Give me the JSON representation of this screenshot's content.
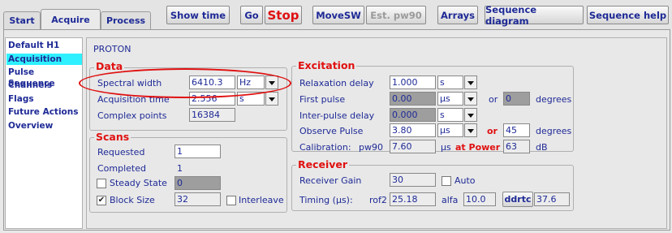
{
  "tabs": [
    {
      "label": "Start"
    },
    {
      "label": "Acquire"
    },
    {
      "label": "Process"
    }
  ],
  "toolbar": {
    "show_time": "Show time",
    "go": "Go",
    "stop": "Stop",
    "movesw": "MoveSW",
    "est_pw90": "Est. pw90",
    "arrays": "Arrays",
    "sequence_diagram": "Sequence diagram",
    "sequence_help": "Sequence help"
  },
  "nav": {
    "items": [
      {
        "label": "Default H1"
      },
      {
        "label": "Acquisition"
      },
      {
        "label": "Pulse Sequence"
      },
      {
        "label": "Channels"
      },
      {
        "label": "Flags"
      },
      {
        "label": "Future Actions"
      },
      {
        "label": "Overview"
      }
    ]
  },
  "nucleus": "PROTON",
  "data_group": {
    "title": "Data",
    "spectral_width_label": "Spectral width",
    "spectral_width_value": "6410.3",
    "spectral_width_unit": "Hz",
    "acq_time_label": "Acquisition time",
    "acq_time_value": "2.556",
    "acq_time_unit": "s",
    "complex_points_label": "Complex points",
    "complex_points_value": "16384"
  },
  "scans_group": {
    "title": "Scans",
    "requested_label": "Requested",
    "requested_value": "1",
    "completed_label": "Completed",
    "completed_value": "1",
    "steady_state_label": "Steady State",
    "steady_state_value": "0",
    "block_size_label": "Block Size",
    "block_size_value": "32",
    "block_size_check": "✔",
    "interleave_label": "Interleave"
  },
  "excitation_group": {
    "title": "Excitation",
    "relax_label": "Relaxation delay",
    "relax_value": "1.000",
    "relax_unit": "s",
    "first_pulse_label": "First pulse",
    "first_pulse_value": "0.00",
    "first_pulse_unit": "μs",
    "first_or": "or",
    "first_deg_value": "0",
    "first_deg_label": "degrees",
    "inter_label": "Inter-pulse delay",
    "inter_value": "0.000",
    "inter_unit": "s",
    "observe_label": "Observe Pulse",
    "observe_value": "3.80",
    "observe_unit": "μs",
    "observe_or": "or",
    "observe_deg_value": "45",
    "observe_deg_label": "degrees",
    "calib_label": "Calibration:",
    "pw90_label": "pw90",
    "pw90_value": "7.60",
    "pw90_unit": "μs",
    "at_power_label": "at Power",
    "power_value": "63",
    "power_unit": "dB"
  },
  "receiver_group": {
    "title": "Receiver",
    "gain_label": "Receiver Gain",
    "gain_value": "30",
    "auto_label": "Auto",
    "timing_label": "Timing (μs):",
    "rof2_label": "rof2",
    "rof2_value": "25.18",
    "alfa_label": "alfa",
    "alfa_value": "10.0",
    "ddrtc_label": "ddrtc",
    "ddrtc_value": "37.6"
  },
  "colors": {
    "accent_text": "#1e2a96",
    "group_title": "#e01010",
    "selected_nav": "#2ff0ff"
  }
}
